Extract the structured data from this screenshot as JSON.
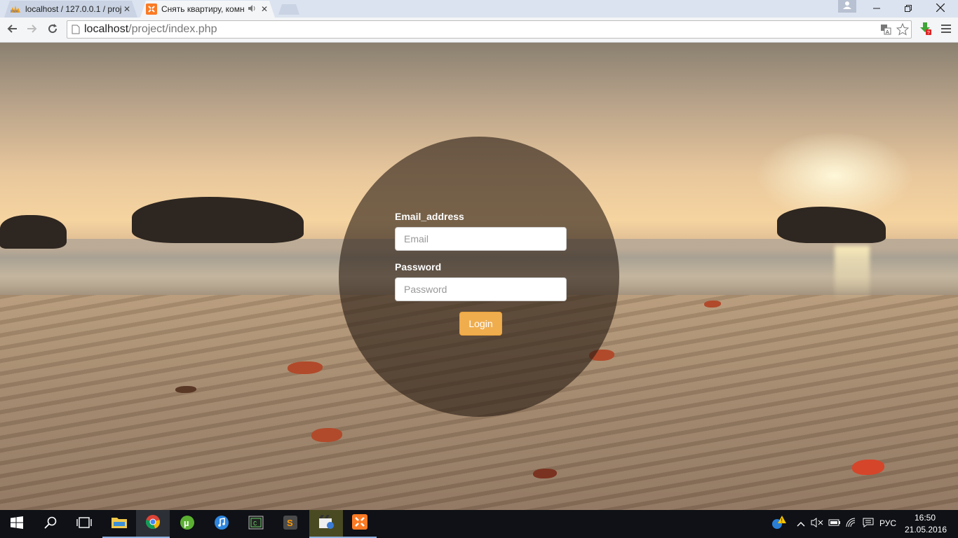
{
  "browser": {
    "tabs": [
      {
        "title": "localhost / 127.0.0.1 / proj",
        "icon": "phpmyadmin-icon",
        "active": false
      },
      {
        "title": "Снять квартиру, комн",
        "icon": "xampp-icon",
        "active": true,
        "audio": true
      }
    ],
    "address_bar": {
      "host": "localhost",
      "path": "/project/index.php"
    }
  },
  "login": {
    "email_label": "Email_address",
    "email_placeholder": "Email",
    "password_label": "Password",
    "password_placeholder": "Password",
    "submit_label": "Login"
  },
  "taskbar": {
    "apps": [
      "start-icon",
      "search-icon",
      "task-view-icon",
      "file-explorer-icon",
      "chrome-icon",
      "utorrent-icon",
      "itunes-icon",
      "terminal-icon",
      "sublime-text-icon",
      "media-icon",
      "xampp-icon"
    ],
    "tray": {
      "language": "РУС",
      "time": "16:50",
      "date": "21.05.2016"
    }
  },
  "colors": {
    "accent_button": "#f0ad4e",
    "circle_overlay": "rgba(40,28,20,0.62)",
    "taskbar": "#0f1116"
  }
}
